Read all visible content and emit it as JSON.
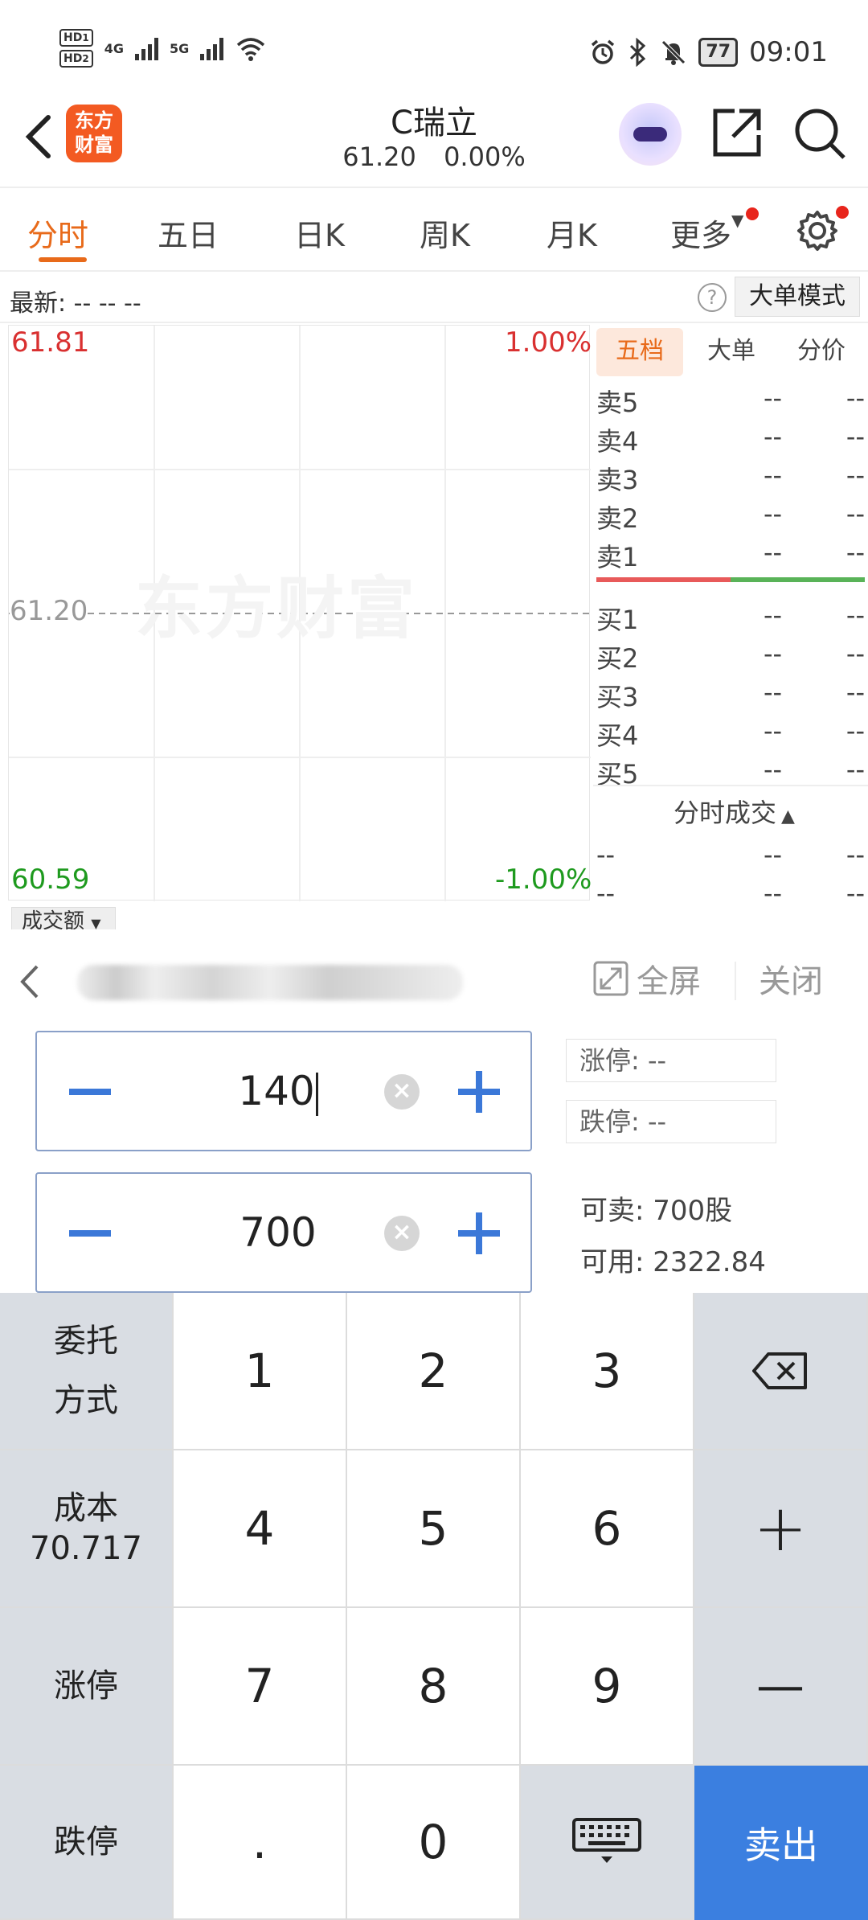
{
  "status_bar": {
    "hd1": "HD",
    "hd1_sub": "1",
    "hd2": "HD",
    "hd2_sub": "2",
    "net1": "4G",
    "net2": "5G",
    "battery": "77",
    "time": "09:01"
  },
  "header": {
    "logo_line1": "东方",
    "logo_line2": "财富",
    "title": "C瑞立",
    "price": "61.20",
    "change": "0.00%"
  },
  "tabs": [
    {
      "label": "分时"
    },
    {
      "label": "五日"
    },
    {
      "label": "日K"
    },
    {
      "label": "周K"
    },
    {
      "label": "月K"
    },
    {
      "label": "更多"
    }
  ],
  "info": {
    "latest": "最新: -- -- --",
    "mode": "大单模式"
  },
  "chart": {
    "high": "61.81",
    "high_pct": "1.00%",
    "mid": "61.20",
    "low": "60.59",
    "low_pct": "-1.00%",
    "watermark": "东方财富",
    "volume_label": "成交额"
  },
  "orderbook": {
    "tabs": [
      "五档",
      "大单",
      "分价"
    ],
    "sell": [
      {
        "label": "卖5",
        "v1": "--",
        "v2": "--"
      },
      {
        "label": "卖4",
        "v1": "--",
        "v2": "--"
      },
      {
        "label": "卖3",
        "v1": "--",
        "v2": "--"
      },
      {
        "label": "卖2",
        "v1": "--",
        "v2": "--"
      },
      {
        "label": "卖1",
        "v1": "--",
        "v2": "--"
      }
    ],
    "buy": [
      {
        "label": "买1",
        "v1": "--",
        "v2": "--"
      },
      {
        "label": "买2",
        "v1": "--",
        "v2": "--"
      },
      {
        "label": "买3",
        "v1": "--",
        "v2": "--"
      },
      {
        "label": "买4",
        "v1": "--",
        "v2": "--"
      },
      {
        "label": "买5",
        "v1": "--",
        "v2": "--"
      }
    ],
    "trades_title": "分时成交",
    "trades": [
      {
        "c1": "--",
        "c2": "--",
        "c3": "--"
      },
      {
        "c1": "--",
        "c2": "--",
        "c3": "--"
      }
    ]
  },
  "panel": {
    "fullscreen": "全屏",
    "close": "关闭",
    "price_value": "140",
    "qty_value": "700",
    "limit_up": "涨停: --",
    "limit_down": "跌停: --",
    "sellable": "可卖: 700股",
    "available": "可用: 2322.84"
  },
  "keypad": {
    "order_type": "委托\n方式",
    "cost_label": "成本",
    "cost_value": "70.717",
    "limit_up_key": "涨停",
    "limit_down_key": "跌停",
    "digits": [
      "1",
      "2",
      "3",
      "4",
      "5",
      "6",
      "7",
      "8",
      "9",
      ".",
      "0"
    ],
    "plus": "+",
    "minus": "—",
    "sell": "卖出"
  },
  "colors": {
    "accent_orange": "#e86a1a",
    "up_red": "#d93030",
    "down_green": "#1e9a1e",
    "sell_blue": "#3b7fe0"
  }
}
